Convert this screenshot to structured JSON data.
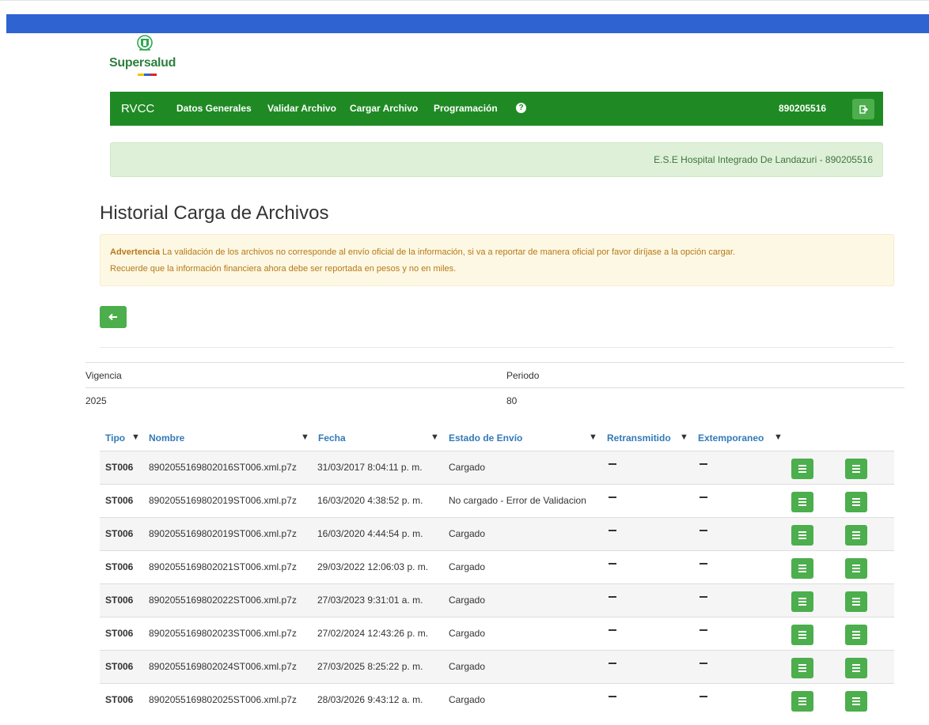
{
  "logo": {
    "text": "Supersalud",
    "stripe_colors": [
      "#f4c400",
      "#2f63d2",
      "#d62828"
    ]
  },
  "navbar": {
    "brand": "RVCC",
    "items": [
      {
        "label": "Datos Generales"
      },
      {
        "label": "Validar Archivo"
      },
      {
        "label": "Cargar Archivo"
      },
      {
        "label": "Programación"
      }
    ],
    "help_icon": "?",
    "user": "890205516",
    "colors": {
      "bar": "#1f8a24",
      "button": "#4cae4c"
    }
  },
  "entity_info": "E.S.E Hospital Integrado De Landazuri - 890205516",
  "page_title": "Historial Carga de Archivos",
  "warning": {
    "strong": "Advertencia",
    "line1": "La validación de los archivos no corresponde al envío oficial de la información, si va a reportar de manera oficial por favor diríjase a la opción cargar.",
    "line2": "Recuerde que la información financiera ahora debe ser reportada en pesos y no en miles."
  },
  "meta": {
    "vigencia_label": "Vigencia",
    "periodo_label": "Periodo",
    "vigencia_value": "2025",
    "periodo_value": "80"
  },
  "table": {
    "columns": [
      "Tipo",
      "Nombre",
      "Fecha",
      "Estado de Envío",
      "Retransmitido",
      "Extemporaneo"
    ],
    "rows": [
      {
        "tipo": "ST006",
        "nombre": "8902055169802016ST006.xml.p7z",
        "fecha": "31/03/2017 8:04:11 p. m.",
        "estado": "Cargado"
      },
      {
        "tipo": "ST006",
        "nombre": "8902055169802019ST006.xml.p7z",
        "fecha": "16/03/2020 4:38:52 p. m.",
        "estado": "No cargado - Error de Validacion"
      },
      {
        "tipo": "ST006",
        "nombre": "8902055169802019ST006.xml.p7z",
        "fecha": "16/03/2020 4:44:54 p. m.",
        "estado": "Cargado"
      },
      {
        "tipo": "ST006",
        "nombre": "8902055169802021ST006.xml.p7z",
        "fecha": "29/03/2022 12:06:03 p. m.",
        "estado": "Cargado"
      },
      {
        "tipo": "ST006",
        "nombre": "8902055169802022ST006.xml.p7z",
        "fecha": "27/03/2023 9:31:01 a. m.",
        "estado": "Cargado"
      },
      {
        "tipo": "ST006",
        "nombre": "8902055169802023ST006.xml.p7z",
        "fecha": "27/02/2024 12:43:26 p. m.",
        "estado": "Cargado"
      },
      {
        "tipo": "ST006",
        "nombre": "8902055169802024ST006.xml.p7z",
        "fecha": "27/03/2025 8:25:22 p. m.",
        "estado": "Cargado"
      },
      {
        "tipo": "ST006",
        "nombre": "8902055169802025ST006.xml.p7z",
        "fecha": "28/03/2026 9:43:12 a. m.",
        "estado": "Cargado"
      }
    ]
  }
}
